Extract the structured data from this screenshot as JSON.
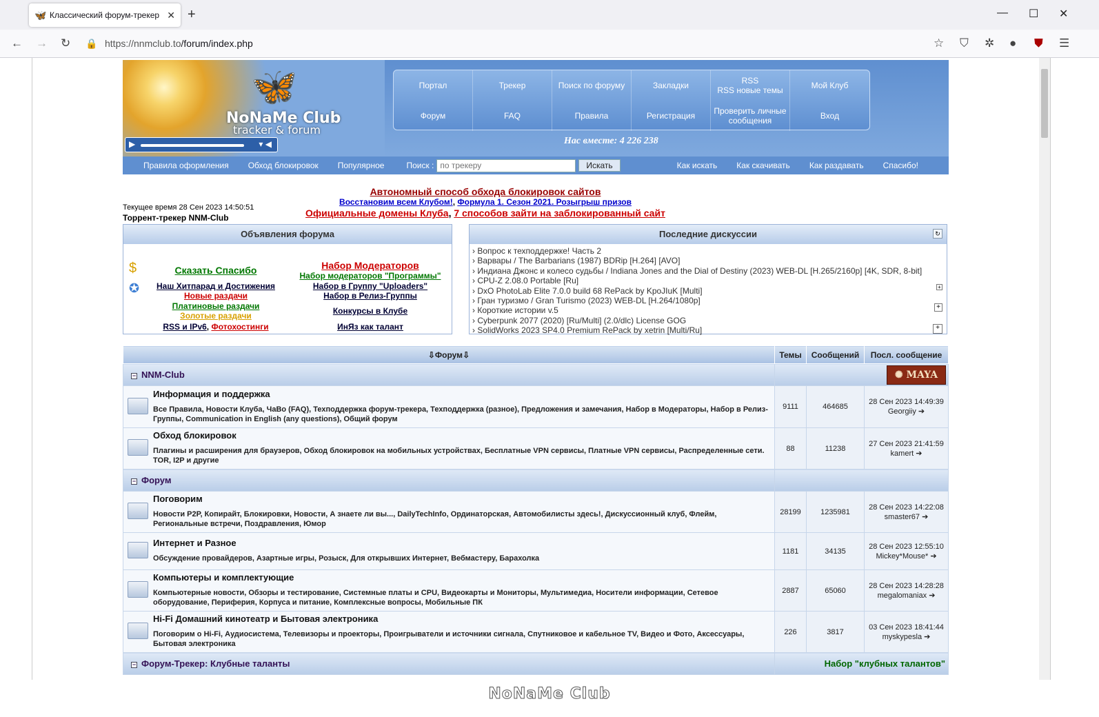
{
  "browser": {
    "tab_title": "Классический форум-трекер",
    "url_host": "https://nnmclub.to",
    "url_path": "/forum/index.php"
  },
  "site": {
    "logo_main": "NoNaMe Club",
    "logo_sub": "tracker & forum",
    "together": "Нас вместе: 4 226 238",
    "menu": [
      "Портал",
      "Трекер",
      "Поиск по форуму",
      "Закладки",
      "RSS\nRSS новые темы",
      "Мой Клуб",
      "Форум",
      "FAQ",
      "Правила",
      "Регистрация",
      "Проверить личные сообщения",
      "Вход"
    ],
    "subnav_left": [
      "Правила оформления",
      "Обход блокировок",
      "Популярное"
    ],
    "search_label": "Поиск :",
    "search_placeholder": "по трекеру",
    "search_button": "Искать",
    "subnav_right": [
      "Как искать",
      "Как скачивать",
      "Как раздавать",
      "Спасибо!"
    ],
    "footer_logo": "NoNaMe Club"
  },
  "announce": {
    "line1": "Автономный способ обхода блокировок сайтов",
    "line2a": "Восстановим всем Клубом!",
    "line2b": "Формула 1. Сезон 2021. Розыгрыш призов",
    "line3a": "Официальные домены Клуба",
    "line3b": "7 способов зайти на заблокированный сайт",
    "current_time": "Текущее время 28 Сен 2023 14:50:51",
    "tracker_title": "Торрент-трекер NNM-Club"
  },
  "board": {
    "title": "Объявления форума",
    "left": [
      "Сказать Спасибо",
      "Наш Хитпарад и Достижения",
      "Новые раздачи",
      "Платиновые раздачи",
      "Золотые раздачи",
      "RSS и IPv6",
      "Фотохостинги"
    ],
    "right": [
      "Набор Модераторов",
      "Набор модераторов \"Программы\"",
      "Набор в Группу \"Uploaders\"",
      "Набор в Релиз-Группы",
      "Конкурсы в Клубе",
      "ИнЯз как талант"
    ]
  },
  "discussions": {
    "title": "Последние дискуссии",
    "items": [
      "Вопрос к техподдержке! Часть 2",
      "Варвары / The Barbarians (1987) BDRip [H.264] [AVO]",
      "Индиана Джонс и колесо судьбы / Indiana Jones and the Dial of Destiny (2023) WEB-DL [H.265/2160p] [4K, SDR, 8-bit]",
      "CPU-Z 2.08.0 Portable [Ru]",
      "DxO PhotoLab Elite 7.0.0 build 68 RePack by KpoJIuK [Multi]",
      "Гран туризмо / Gran Turismo (2023) WEB-DL [H.264/1080p]",
      "Короткие истории v.5",
      "Cyberpunk 2077 (2020) [Ru/Multi] (2.0/dlc) License GOG",
      "SolidWorks 2023 SP4.0 Premium RePack by xetrin [Multi/Ru]"
    ]
  },
  "forums_table": {
    "head_forum": "Форум",
    "head_topics": "Темы",
    "head_posts": "Сообщений",
    "head_last": "Посл. сообщение",
    "cat1": "NNM-Club",
    "cat2": "Форум",
    "cat3": "Форум-Трекер: Клубные таланты",
    "cat3_right": "Набор \"клубных талантов\"",
    "rows": [
      {
        "name": "Информация и поддержка",
        "subs": "Все Правила, Новости Клуба, ЧаВо (FAQ), Техподдержка форум-трекера, Техподдержка (разное), Предложения и замечания, Набор в Модераторы, Набор в Релиз-Группы, Communication in English (any questions), Общий форум",
        "topics": "9111",
        "posts": "464685",
        "last_date": "28 Сен 2023 14:49:39",
        "last_user": "Georgiiy"
      },
      {
        "name": "Обход блокировок",
        "subs": "Плагины и расширения для браузеров, Обход блокировок на мобильных устройствах, Бесплатные VPN сервисы, Платные VPN сервисы, Распределенные сети. TOR, I2P и другие",
        "topics": "88",
        "posts": "11238",
        "last_date": "27 Сен 2023 21:41:59",
        "last_user": "kamert"
      },
      {
        "name": "Поговорим",
        "subs": "Новости P2P, Копирайт, Блокировки, Новости, А знаете ли вы..., DailyTechInfo, Ординаторская, Автомобилисты здесь!, Дискуссионный клуб, Флейм, Региональные встречи, Поздравления, Юмор",
        "topics": "28199",
        "posts": "1235981",
        "last_date": "28 Сен 2023 14:22:08",
        "last_user": "smaster67"
      },
      {
        "name": "Интернет и Разное",
        "subs": "Обсуждение провайдеров, Азартные игры, Розыск, Для открывших Интернет, Вебмастеру, Барахолка",
        "topics": "1181",
        "posts": "34135",
        "last_date": "28 Сен 2023 12:55:10",
        "last_user": "Mickey*Mouse*"
      },
      {
        "name": "Компьютеры и комплектующие",
        "subs": "Компьютерные новости, Обзоры и тестирование, Системные платы и CPU, Видеокарты и Мониторы, Мультимедиа, Носители информации, Сетевое оборудование, Периферия, Корпуса и питание, Комплексные вопросы, Мобильные ПК",
        "topics": "2887",
        "posts": "65060",
        "last_date": "28 Сен 2023 14:28:28",
        "last_user": "megalomaniax"
      },
      {
        "name": "Hi-Fi Домашний кинотеатр и Бытовая электроника",
        "subs": "Поговорим о Hi-Fi, Аудиосистема, Телевизоры и проекторы, Проигрыватели и источники сигнала, Спутниковое и кабельное TV, Видео и Фото, Аксессуары, Бытовая электроника",
        "topics": "226",
        "posts": "3817",
        "last_date": "03 Сен 2023 18:41:44",
        "last_user": "myskypesla"
      }
    ]
  }
}
